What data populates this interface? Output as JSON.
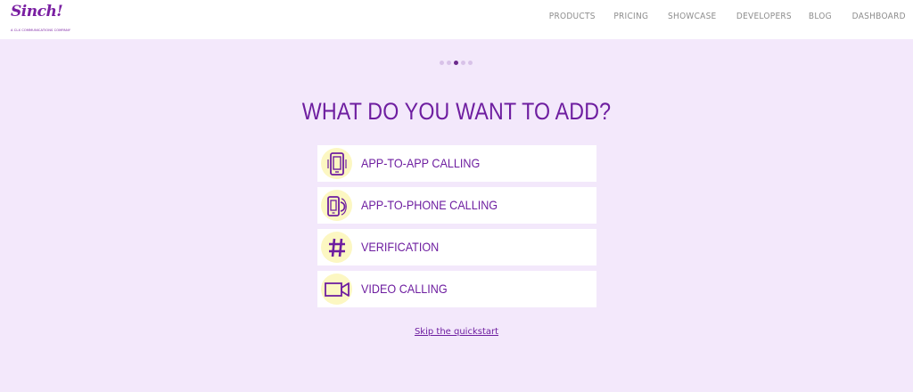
{
  "brand": {
    "name": "Sinch!",
    "tagline": "A CLX COMMUNICATIONS COMPANY",
    "color": "#7a1fa2"
  },
  "nav": {
    "items": [
      {
        "label": "PRODUCTS"
      },
      {
        "label": "PRICING"
      },
      {
        "label": "SHOWCASE"
      },
      {
        "label": "DEVELOPERS"
      },
      {
        "label": "BLOG"
      },
      {
        "label": "DASHBOARD"
      }
    ]
  },
  "stepper": {
    "total": 5,
    "active_index": 2
  },
  "main": {
    "heading": "WHAT DO YOU WANT TO ADD?",
    "options": [
      {
        "label": "APP-TO-APP CALLING",
        "icon": "app-to-app-phone-icon"
      },
      {
        "label": "APP-TO-PHONE CALLING",
        "icon": "app-to-phone-icon"
      },
      {
        "label": "VERIFICATION",
        "icon": "hash-icon"
      },
      {
        "label": "VIDEO CALLING",
        "icon": "video-camera-icon"
      }
    ],
    "skip_label": "Skip the quickstart"
  },
  "colors": {
    "background": "#f3e8fb",
    "accent": "#6e1ea0",
    "icon_circle": "#fcf7c2"
  }
}
